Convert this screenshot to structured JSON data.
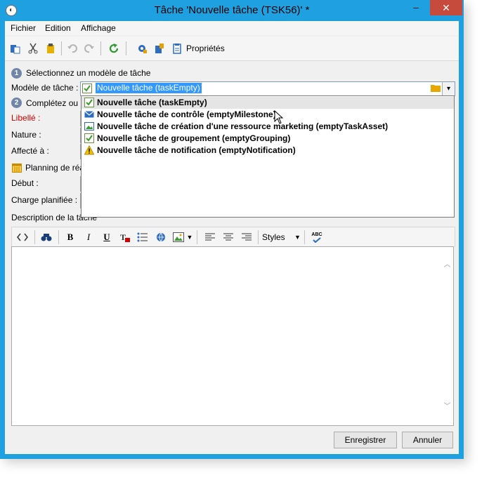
{
  "window": {
    "title": "Tâche 'Nouvelle tâche (TSK56)' *",
    "minimize": "–",
    "maximize": "□",
    "close": "✕"
  },
  "menu": {
    "items": [
      "Fichier",
      "Edition",
      "Affichage"
    ]
  },
  "toolbar": {
    "properties_label": "Propriétés"
  },
  "form": {
    "step1_num": "1",
    "step1_label": "Sélectionnez un modèle de tâche",
    "template_label": "Modèle de tâche :",
    "template_value": "Nouvelle tâche (taskEmpty)",
    "step2_num": "2",
    "step2_label": "Complétez ou",
    "libelle_label": "Libellé :",
    "nature_label": "Nature :",
    "affecte_label": "Affecté à :",
    "planning_label": "Planning de réa",
    "debut_label": "Début :",
    "charge_label": "Charge planifiée :",
    "description_label": "Description de la tâche"
  },
  "dropdown": {
    "options": [
      {
        "label": "Nouvelle tâche (taskEmpty)",
        "icon": "check-icon",
        "selected": true
      },
      {
        "label": "Nouvelle tâche de contrôle (emptyMilestone)",
        "icon": "envelope-icon",
        "selected": false
      },
      {
        "label": "Nouvelle tâche de création d'une ressource marketing (emptyTaskAsset)",
        "icon": "image-icon",
        "selected": false
      },
      {
        "label": "Nouvelle tâche de groupement (emptyGrouping)",
        "icon": "check-icon",
        "selected": false
      },
      {
        "label": "Nouvelle tâche de notification (emptyNotification)",
        "icon": "warning-icon",
        "selected": false
      }
    ]
  },
  "editor": {
    "bold": "B",
    "italic": "I",
    "underline": "U",
    "styles_label": "Styles",
    "spell": "ABC"
  },
  "buttons": {
    "save": "Enregistrer",
    "cancel": "Annuler"
  },
  "colors": {
    "titlebar": "#1fa0e0",
    "highlight": "#3399ff",
    "required": "#d40000",
    "close": "#c74b3c"
  }
}
